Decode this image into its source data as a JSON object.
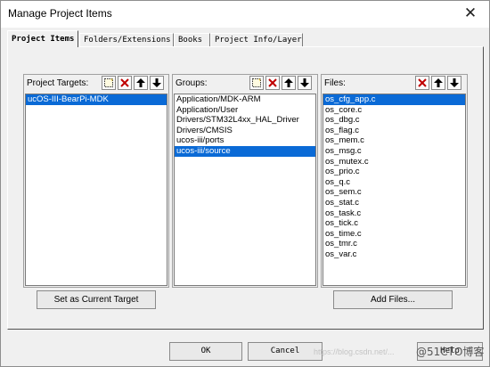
{
  "window": {
    "title": "Manage Project Items",
    "close_glyph": "✕"
  },
  "tabs": [
    {
      "label": "Project Items",
      "active": true
    },
    {
      "label": "Folders/Extensions",
      "active": false
    },
    {
      "label": "Books",
      "active": false
    },
    {
      "label": "Project Info/Layer",
      "active": false
    }
  ],
  "targets": {
    "label": "Project Targets:",
    "toolbar_icons": [
      "new-icon",
      "delete-icon",
      "move-up-icon",
      "move-down-icon"
    ],
    "items": [
      "ucOS-III-BearPi-MDK"
    ],
    "selected_index": 0,
    "button_label": "Set as Current Target"
  },
  "groups": {
    "label": "Groups:",
    "toolbar_icons": [
      "new-icon",
      "delete-icon",
      "move-up-icon",
      "move-down-icon"
    ],
    "items": [
      "Application/MDK-ARM",
      "Application/User",
      "Drivers/STM32L4xx_HAL_Driver",
      "Drivers/CMSIS",
      "ucos-iii/ports",
      "ucos-iii/source"
    ],
    "selected_index": 5
  },
  "files": {
    "label": "Files:",
    "toolbar_icons": [
      "delete-icon",
      "move-up-icon",
      "move-down-icon"
    ],
    "items": [
      "os_cfg_app.c",
      "os_core.c",
      "os_dbg.c",
      "os_flag.c",
      "os_mem.c",
      "os_msg.c",
      "os_mutex.c",
      "os_prio.c",
      "os_q.c",
      "os_sem.c",
      "os_stat.c",
      "os_task.c",
      "os_tick.c",
      "os_time.c",
      "os_tmr.c",
      "os_var.c"
    ],
    "selected_index": 0,
    "button_label": "Add Files..."
  },
  "footer": {
    "ok_label": "OK",
    "cancel_label": "Cancel",
    "help_label": "Help"
  },
  "watermarks": {
    "url": "https://blog.csdn.net/... ",
    "brand": "@51CTO博客"
  },
  "colors": {
    "selection": "#0a6ad6",
    "delete_red": "#c00000"
  }
}
